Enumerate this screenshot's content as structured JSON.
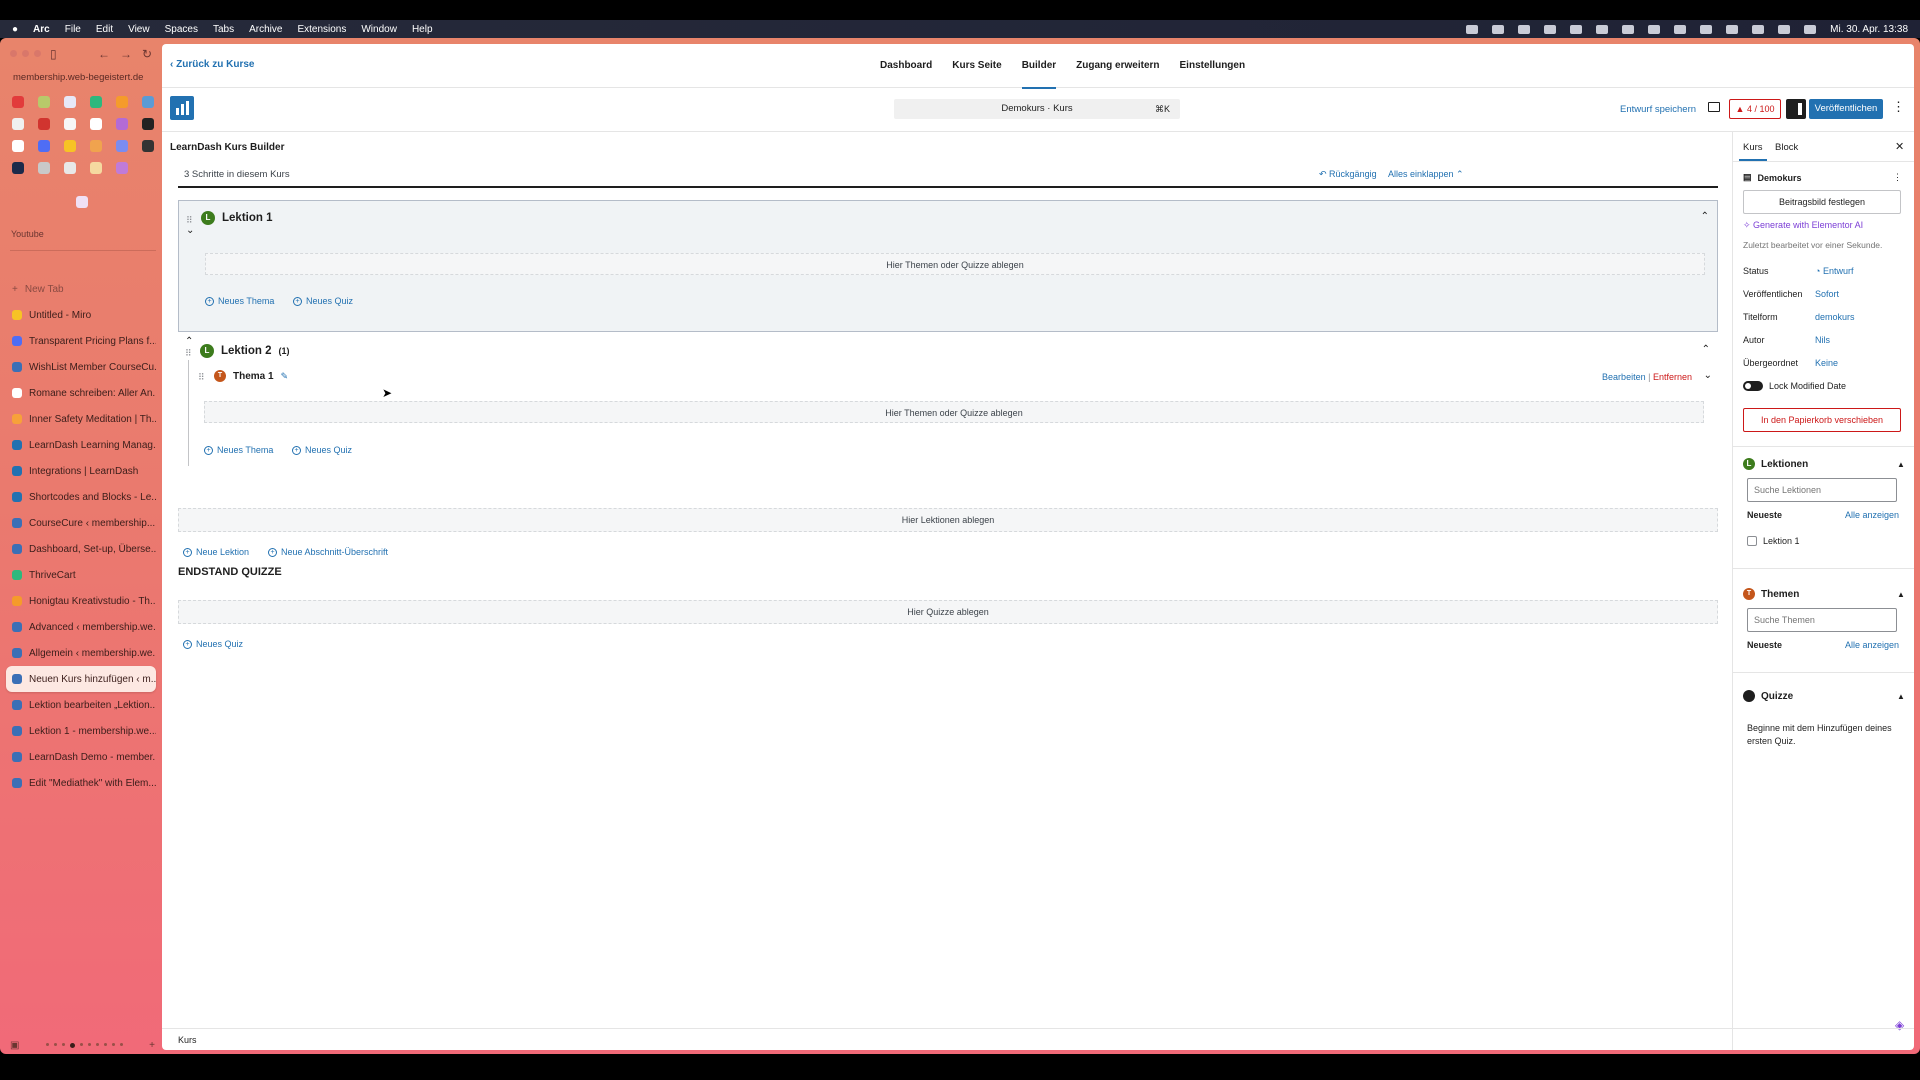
{
  "menubar": {
    "apple": "",
    "app": "Arc",
    "items": [
      "File",
      "Edit",
      "View",
      "Spaces",
      "Tabs",
      "Archive",
      "Extensions",
      "Window",
      "Help"
    ],
    "datetime": "Mi. 30. Apr. 13:38"
  },
  "sidebar": {
    "url": "membership.web-begeistert.de",
    "folder": "Youtube",
    "new_tab": "New Tab",
    "tabs": [
      {
        "label": "Untitled - Miro",
        "color": "#f7c325"
      },
      {
        "label": "Transparent Pricing Plans f...",
        "color": "#4f6df5"
      },
      {
        "label": "WishList Member CourseCu...",
        "color": "#3b6fb6"
      },
      {
        "label": "Romane schreiben: Aller An...",
        "color": "#ffffff"
      },
      {
        "label": "Inner Safety Meditation | Th...",
        "color": "#f7a13a"
      },
      {
        "label": "LearnDash Learning Manag...",
        "color": "#2271b1"
      },
      {
        "label": "Integrations | LearnDash",
        "color": "#2271b1"
      },
      {
        "label": "Shortcodes and Blocks - Le...",
        "color": "#2271b1"
      },
      {
        "label": "CourseCure ‹ membership...",
        "color": "#3b6fb6"
      },
      {
        "label": "Dashboard, Set-up, Überse...",
        "color": "#3b6fb6"
      },
      {
        "label": "ThriveCart",
        "color": "#2db87d"
      },
      {
        "label": "Honigtau Kreativstudio - Th...",
        "color": "#f59b2b"
      },
      {
        "label": "Advanced ‹ membership.we...",
        "color": "#3b6fb6"
      },
      {
        "label": "Allgemein ‹ membership.we...",
        "color": "#3b6fb6"
      },
      {
        "label": "Neuen Kurs hinzufügen ‹ m...",
        "color": "#3b6fb6"
      },
      {
        "label": "Lektion bearbeiten „Lektion...",
        "color": "#3b6fb6"
      },
      {
        "label": "Lektion 1 - membership.we...",
        "color": "#3b6fb6"
      },
      {
        "label": "LearnDash Demo - member...",
        "color": "#3b6fb6"
      },
      {
        "label": "Edit \"Mediathek\" with Elem...",
        "color": "#3b6fb6"
      }
    ]
  },
  "topnav": {
    "back": "Zurück zu Kurse",
    "tabs": [
      "Dashboard",
      "Kurs Seite",
      "Builder",
      "Zugang erweitern",
      "Einstellungen"
    ],
    "active_tab": "Builder"
  },
  "editor": {
    "command": "Demokurs · Kurs",
    "shortcut": "⌘K",
    "save_draft": "Entwurf speichern",
    "counter": "4 / 100",
    "publish": "Veröffentlichen"
  },
  "builder": {
    "title": "LearnDash Kurs Builder",
    "steps": "3 Schritte in diesem Kurs",
    "undo": "Rückgängig",
    "collapse_all": "Alles einklappen",
    "lesson1": {
      "badge": "L",
      "title": "Lektion 1",
      "drop": "Hier Themen oder Quizze ablegen",
      "new_topic": "Neues Thema",
      "new_quiz": "Neues Quiz"
    },
    "lesson2": {
      "badge": "L",
      "title": "Lektion 2",
      "count": "(1)",
      "topic_badge": "T",
      "topic": "Thema 1",
      "edit": "Bearbeiten",
      "sep": "|",
      "remove": "Entfernen",
      "drop": "Hier Themen oder Quizze ablegen",
      "new_topic": "Neues Thema",
      "new_quiz": "Neues Quiz"
    },
    "lessons_drop": "Hier Lektionen ablegen",
    "new_lesson": "Neue Lektion",
    "new_heading": "Neue Abschnitt-Überschrift",
    "final_quizzes": "ENDSTAND QUIZZE",
    "quizzes_drop": "Hier Quizze ablegen",
    "new_quiz": "Neues Quiz"
  },
  "panel": {
    "tab_course": "Kurs",
    "tab_block": "Block",
    "name": "Demokurs",
    "featured": "Beitragsbild festlegen",
    "ai": "Generate with Elementor AI",
    "last_edited": "Zuletzt bearbeitet vor einer Sekunde.",
    "status_label": "Status",
    "status_value": "Entwurf",
    "publish_label": "Veröffentlichen",
    "publish_value": "Sofort",
    "slug_label": "Titelform",
    "slug_value": "demokurs",
    "author_label": "Autor",
    "author_value": "Nils",
    "parent_label": "Übergeordnet",
    "parent_value": "Keine",
    "lock": "Lock Modified Date",
    "trash": "In den Papierkorb verschieben",
    "lessons_title": "Lektionen",
    "lessons_search": "Suche Lektionen",
    "newest": "Neueste",
    "show_all": "Alle anzeigen",
    "lesson_item": "Lektion 1",
    "topics_title": "Themen",
    "topics_search": "Suche Themen",
    "quizzes_title": "Quizze",
    "quizzes_text": "Beginne mit dem Hinzufügen deines ersten Quiz."
  },
  "status_bar": "Kurs"
}
